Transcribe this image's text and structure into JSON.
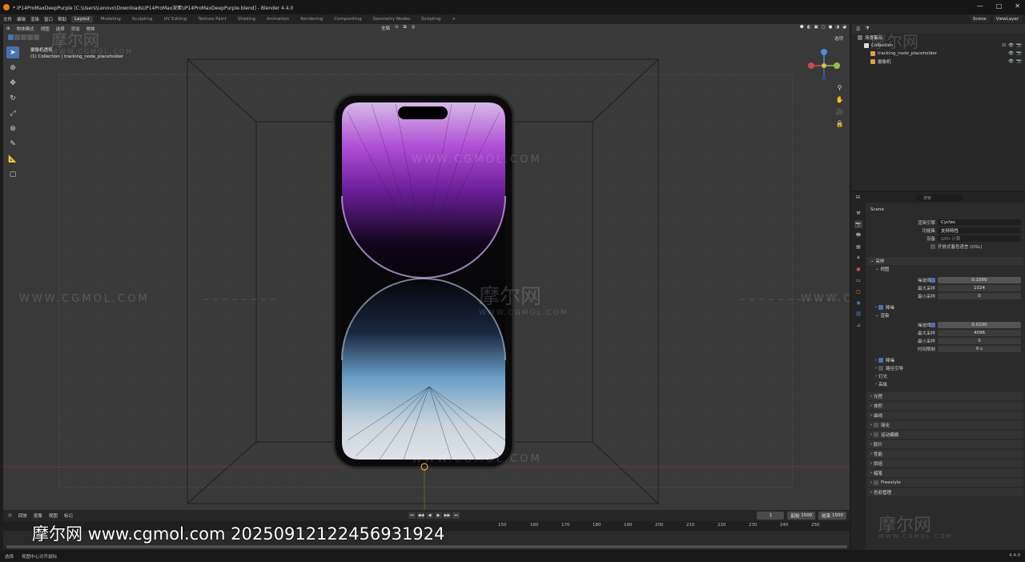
{
  "window": {
    "title": "* iP14ProMaxDeepPurple [C:\\Users\\Lenovo\\Downloads\\iP14ProMax深紫\\iP14ProMaxDeepPurple.blend] - Blender 4.4.0",
    "controls": [
      "—",
      "□",
      "✕"
    ]
  },
  "menu": {
    "items": [
      "文件",
      "编辑",
      "渲染",
      "窗口",
      "帮助"
    ],
    "workspaces": [
      "Layout",
      "Modeling",
      "Sculpting",
      "UV Editing",
      "Texture Paint",
      "Shading",
      "Animation",
      "Rendering",
      "Compositing",
      "Geometry Nodes",
      "Scripting",
      "+"
    ],
    "active_workspace": "Layout",
    "scene": "Scene",
    "view_layer": "ViewLayer"
  },
  "viewport": {
    "header_items": [
      "物体模式",
      "视图",
      "选择",
      "添加",
      "物体"
    ],
    "transform_orientation": "全局",
    "select_label": "选项",
    "info_line1": "摄像机透视",
    "info_line2": "(1) Collection | tracking_node_placeholder"
  },
  "watermark": {
    "logo": "摩尔网",
    "site": "WWW.CGMOL.COM",
    "footer": "摩尔网 www.cgmol.com 20250912122456931924"
  },
  "timeline": {
    "header_items": [
      "回放",
      "抠像",
      "视图",
      "标记"
    ],
    "ticks": [
      "150",
      "160",
      "170",
      "180",
      "190",
      "200",
      "210",
      "220",
      "230",
      "240",
      "250"
    ],
    "current_frame": "1",
    "start_label": "起始",
    "start": "1500",
    "end_label": "结束",
    "end": "1500"
  },
  "statusbar": {
    "items": [
      "选择",
      "视图中心对齐鼠标"
    ],
    "version": "4.4.0"
  },
  "outliner": {
    "header": "场景集合",
    "rows": [
      {
        "name": "Collection",
        "indent": 1
      },
      {
        "name": "tracking_node_placeholder",
        "indent": 2
      },
      {
        "name": "摄像机",
        "indent": 2
      }
    ]
  },
  "properties": {
    "search_placeholder": "搜索",
    "scene_label": "Scene",
    "render_engine_label": "渲染引擎",
    "render_engine": "Cycles",
    "feature_set_label": "功能集",
    "feature_set": "支持特性",
    "device_label": "设备",
    "device": "GPU 计算",
    "osl_label": "开放式着色语言 (OSL)",
    "sampling": "采样",
    "viewport": "视图",
    "noise_threshold_label": "噪波阈值",
    "vp_noise_threshold": "0.1000",
    "max_samples_label": "最大采样",
    "vp_max_samples": "1024",
    "min_samples_label": "最小采样",
    "vp_min_samples": "0",
    "denoise": "降噪",
    "render": "渲染",
    "r_noise_threshold": "0.0100",
    "r_max_samples": "4096",
    "r_min_samples": "0",
    "time_limit_label": "时间限制",
    "r_time_limit": "0 s",
    "r_denoise": "降噪",
    "path_guiding": "路径引导",
    "lights": "灯光",
    "advanced": "高级",
    "panels": [
      "光程",
      "体积",
      "曲线",
      "简化",
      "运动模糊",
      "胶片",
      "性能",
      "烘焙",
      "蜡笔",
      "Freestyle",
      "色彩管理"
    ]
  }
}
